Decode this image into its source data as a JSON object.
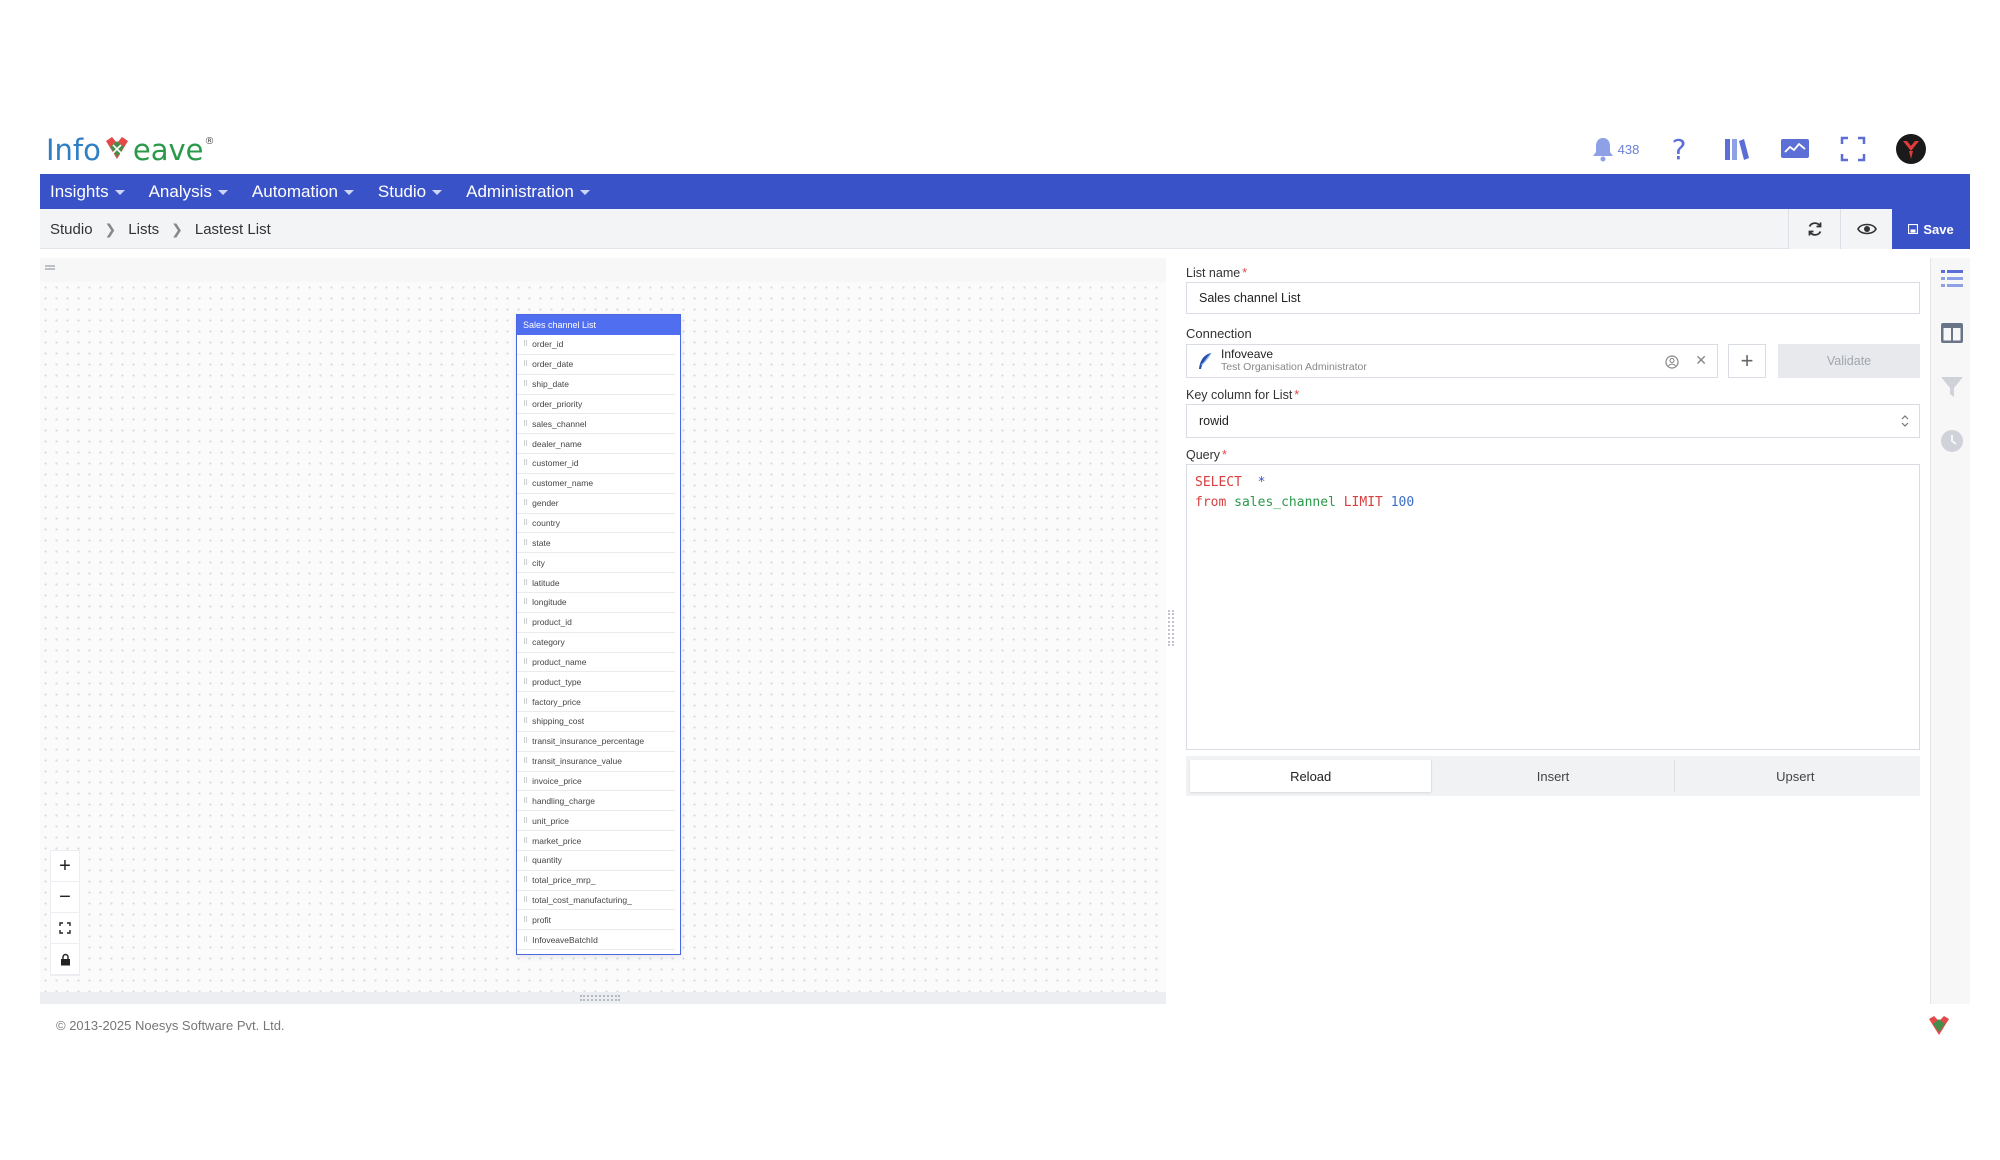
{
  "app": {
    "logo_left": "Info",
    "logo_right": "eave",
    "logo_reg": "®",
    "notification_count": "438"
  },
  "nav": {
    "items": [
      {
        "label": "Insights"
      },
      {
        "label": "Analysis"
      },
      {
        "label": "Automation"
      },
      {
        "label": "Studio"
      },
      {
        "label": "Administration"
      }
    ]
  },
  "breadcrumb": {
    "items": [
      "Studio",
      "Lists",
      "Lastest List"
    ]
  },
  "toolbar": {
    "save_label": "Save"
  },
  "table_card": {
    "title": "Sales channel List",
    "fields": [
      "order_id",
      "order_date",
      "ship_date",
      "order_priority",
      "sales_channel",
      "dealer_name",
      "customer_id",
      "customer_name",
      "gender",
      "country",
      "state",
      "city",
      "latitude",
      "longitude",
      "product_id",
      "category",
      "product_name",
      "product_type",
      "factory_price",
      "shipping_cost",
      "transit_insurance_percentage",
      "transit_insurance_value",
      "invoice_price",
      "handling_charge",
      "unit_price",
      "market_price",
      "quantity",
      "total_price_mrp_",
      "total_cost_manufacturing_",
      "profit",
      "InfoveaveBatchId"
    ]
  },
  "form": {
    "list_name_label": "List name",
    "list_name_value": "Sales channel List",
    "connection_label": "Connection",
    "connection_name": "Infoveave",
    "connection_sub": "Test Organisation Administrator",
    "validate_label": "Validate",
    "key_column_label": "Key column for List",
    "key_column_value": "rowid",
    "query_label": "Query",
    "query": {
      "line1_kw": "SELECT",
      "line1_star": "*",
      "line2_kw1": "from",
      "line2_table": "sales_channel",
      "line2_kw2": "LIMIT",
      "line2_num": "100"
    },
    "modes": [
      "Reload",
      "Insert",
      "Upsert"
    ]
  },
  "footer": {
    "copyright": "© 2013-2025 Noesys Software Pvt. Ltd."
  },
  "colors": {
    "primary": "#3a52c8",
    "table_header": "#4f6ef0",
    "required": "#e04848"
  }
}
